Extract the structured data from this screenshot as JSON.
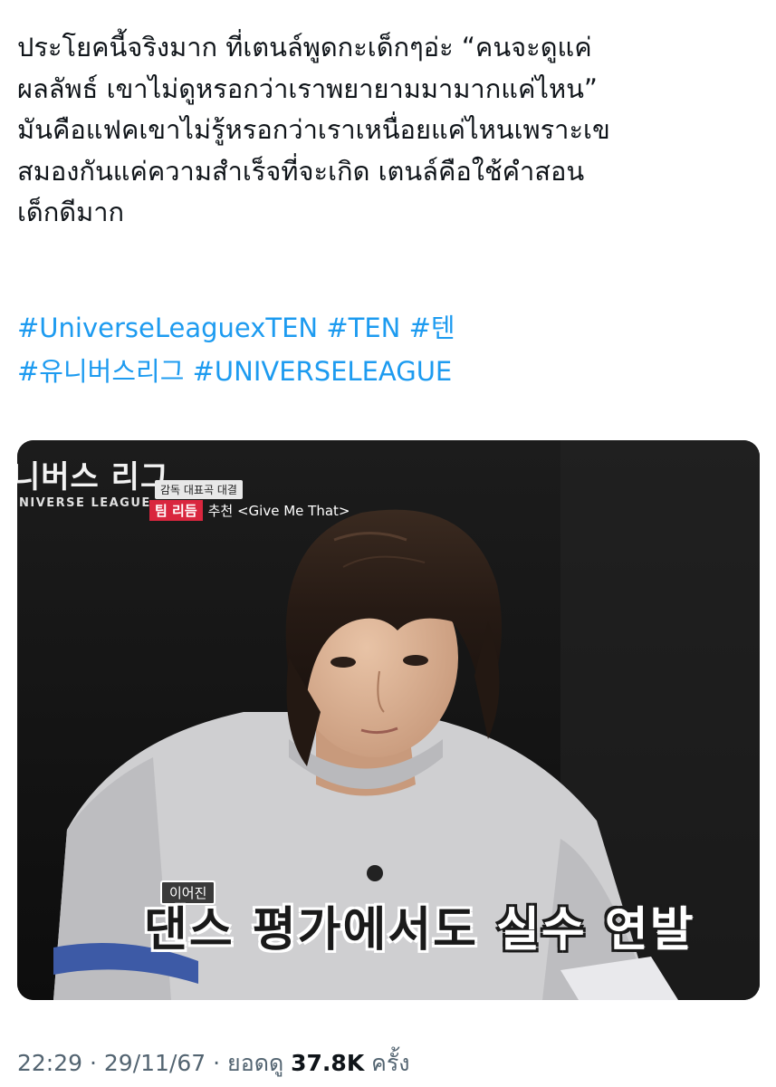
{
  "tweet": {
    "text_lines": [
      "ประโยคนี้จริงมาก ที่เตนล์พูดกะเด็กๆอ่ะ “คนจะดูแค่",
      "ผลลัพธ์ เขาไม่ดูหรอกว่าเราพยายามมามากแค่ไหน”",
      "มันคือแฟคเขาไม่รู้หรอกว่าเราเหนื่อยแค่ไหนเพราะเข",
      "สมองกันแค่ความสำเร็จที่จะเกิด เตนล์คือใช้คำสอน",
      "เด็กดีมาก"
    ],
    "hashtags_line1": [
      "#UniverseLeaguexTEN",
      "#TEN",
      "#텐"
    ],
    "hashtags_line2": [
      "#유니버스리그",
      "#UNIVERSELEAGUE"
    ]
  },
  "media": {
    "show_logo_kr": "니버스 리그",
    "show_logo_en": "NIVERSE LEAGUE",
    "caption_small": "감독 대표곡 대결",
    "caption_team": "팀 리듬",
    "caption_song": "추천 <Give Me That>",
    "subtitle_small": "이어진",
    "subtitle_main": "댄스 평가에서도",
    "subtitle_highlight": "실수 연발"
  },
  "meta": {
    "time": "22:29",
    "sep1": "·",
    "date": "29/11/67",
    "sep2": "·",
    "views_label": "ยอดดู",
    "views_count": "37.8K",
    "views_suffix": "ครั้ง"
  },
  "colors": {
    "text": "#0f1419",
    "link": "#1d9bf0",
    "meta": "#536471"
  }
}
